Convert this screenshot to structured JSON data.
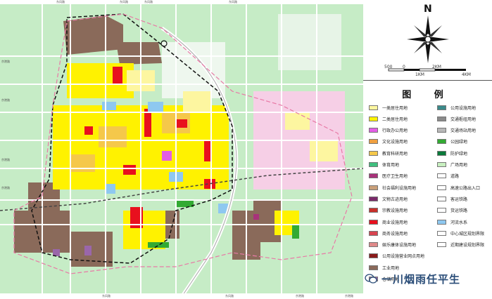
{
  "compass": {
    "north": "N"
  },
  "scale": {
    "ticks": [
      "500",
      "0",
      "1KM",
      "2KM",
      "4KM"
    ]
  },
  "legend": {
    "title": "图 例",
    "left_items": [
      {
        "label": "一类居住用地",
        "color": "#fdf6a0"
      },
      {
        "label": "二类居住用地",
        "color": "#fff200"
      },
      {
        "label": "行政办公用地",
        "color": "#e35de6"
      },
      {
        "label": "文化设施用地",
        "color": "#f0a040"
      },
      {
        "label": "教育科研用地",
        "color": "#f5c84a"
      },
      {
        "label": "体育用地",
        "color": "#3fbf7f"
      },
      {
        "label": "医疗卫生用地",
        "color": "#a8327a"
      },
      {
        "label": "社会福利设施用地",
        "color": "#c9a07a"
      },
      {
        "label": "文物古迹用地",
        "color": "#7a2a6a"
      },
      {
        "label": "宗教设施用地",
        "color": "#c8302a"
      },
      {
        "label": "商业设施用地",
        "color": "#e8101e"
      },
      {
        "label": "商务设施用地",
        "color": "#d84450"
      },
      {
        "label": "娱乐康体设施用地",
        "color": "#e08a8a"
      },
      {
        "label": "公用设施营业网点用地",
        "color": "#8a1a1a"
      },
      {
        "label": "工业用地",
        "color": "#8a6a5a"
      },
      {
        "label": "仓储用地",
        "color": "#9a66aa"
      }
    ],
    "right_items": [
      {
        "label": "公用设施用地",
        "color": "#3a8a8a"
      },
      {
        "label": "交通枢纽用地",
        "color": "#8a8a8a"
      },
      {
        "label": "交通场站用地",
        "color": "#b8b8b8"
      },
      {
        "label": "公园绿地",
        "color": "#33aa33"
      },
      {
        "label": "防护绿地",
        "color": "#0a7a3a"
      },
      {
        "label": "广场用地",
        "color": "#c8f0c0"
      },
      {
        "label": "道路",
        "color": "#ffffff"
      },
      {
        "label": "高速公路出入口",
        "color": "#ffffff"
      },
      {
        "label": "客运铁路",
        "color": "#ffffff"
      },
      {
        "label": "货运铁路",
        "color": "#ffffff"
      },
      {
        "label": "河流水系",
        "color": "#8ec8f0"
      },
      {
        "label": "中心城区规划界限",
        "color": "#ffffff"
      },
      {
        "label": "近期建设规划界限",
        "color": "#ffffff"
      }
    ]
  },
  "watermark": {
    "text": "一川烟雨任平生",
    "icon": "wechat-bubble-icon"
  },
  "road_labels": [
    "东风路",
    "东风路",
    "东风路",
    "东风路",
    "京港路",
    "京港路",
    "京港路",
    "京港路",
    "东风路",
    "东风路",
    "京港路",
    "京港路"
  ],
  "colors": {
    "background_green": "#c6ecc6",
    "residential_yellow": "#fff200",
    "industrial_brown": "#8a6a5a",
    "commercial_red": "#e8101e",
    "water_blue": "#8ec8f0",
    "road_white": "#ffffff",
    "pink_planned": "#f6cfe6"
  }
}
